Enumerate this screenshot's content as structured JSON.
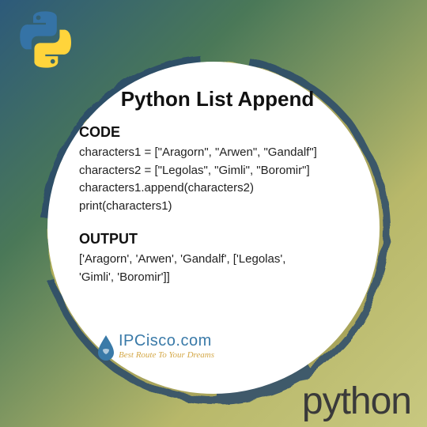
{
  "title": "Python List Append",
  "sections": {
    "code_label": "CODE",
    "code_lines": [
      "characters1 = [\"Aragorn\", \"Arwen\", \"Gandalf\"]",
      "characters2 = [\"Legolas\", \"Gimli\", \"Boromir\"]",
      " characters1.append(characters2)",
      " print(characters1)"
    ],
    "output_label": "OUTPUT",
    "output_lines": [
      "['Aragorn', 'Arwen', 'Gandalf', ['Legolas',",
      "'Gimli', 'Boromir']]"
    ]
  },
  "brand": {
    "name": "IPCisco.com",
    "tagline": "Best Route To Your Dreams"
  },
  "wordmark": "python"
}
